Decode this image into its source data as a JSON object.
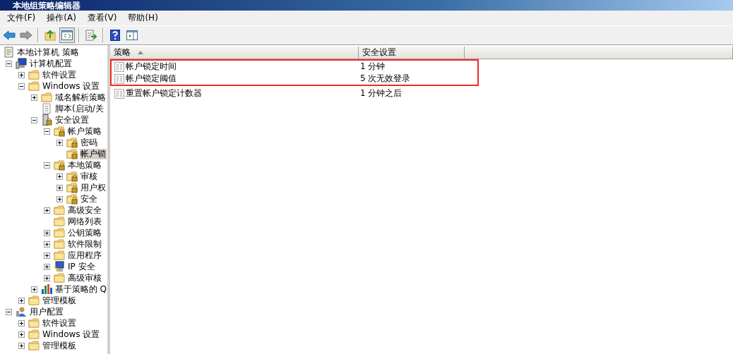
{
  "window": {
    "title": "本地组策略编辑器"
  },
  "menu": [
    "文件(F)",
    "操作(A)",
    "查看(V)",
    "帮助(H)"
  ],
  "toolbar": [
    {
      "kind": "back",
      "pressed": false
    },
    {
      "kind": "forward",
      "pressed": false
    },
    {
      "kind": "sep"
    },
    {
      "kind": "up",
      "pressed": false
    },
    {
      "kind": "tree",
      "pressed": true
    },
    {
      "kind": "sep"
    },
    {
      "kind": "export",
      "pressed": false
    },
    {
      "kind": "sep"
    },
    {
      "kind": "help",
      "pressed": false
    },
    {
      "kind": "pane",
      "pressed": false
    }
  ],
  "tree": {
    "label": "本地计算机 策略",
    "kind": "doc",
    "selected": false,
    "children": [
      {
        "label": "计算机配置",
        "kind": "computer",
        "expanded": true,
        "selected": false,
        "children": [
          {
            "label": "软件设置",
            "kind": "folder",
            "expanded": false,
            "selected": false
          },
          {
            "label": "Windows 设置",
            "kind": "folder",
            "expanded": true,
            "selected": false,
            "children": [
              {
                "label": "域名解析策略",
                "kind": "folder",
                "expanded": false,
                "selected": false
              },
              {
                "label": "脚本(启动/关",
                "kind": "script",
                "selected": false
              },
              {
                "label": "安全设置",
                "kind": "shield",
                "expanded": true,
                "selected": false,
                "children": [
                  {
                    "label": "帐户策略",
                    "kind": "lockfolder",
                    "expanded": true,
                    "selected": false,
                    "children": [
                      {
                        "label": "密码",
                        "kind": "lockfolder",
                        "expanded": false,
                        "selected": false
                      },
                      {
                        "label": "帐户锁",
                        "kind": "lockfolder",
                        "selected": true
                      }
                    ]
                  },
                  {
                    "label": "本地策略",
                    "kind": "lockfolder",
                    "expanded": true,
                    "selected": false,
                    "children": [
                      {
                        "label": "审核",
                        "kind": "lockfolder",
                        "expanded": false,
                        "selected": false
                      },
                      {
                        "label": "用户权",
                        "kind": "lockfolder",
                        "expanded": false,
                        "selected": false
                      },
                      {
                        "label": "安全",
                        "kind": "lockfolder",
                        "expanded": false,
                        "selected": false
                      }
                    ]
                  },
                  {
                    "label": "高级安全",
                    "kind": "folder",
                    "expanded": false,
                    "selected": false
                  },
                  {
                    "label": "网络列表",
                    "kind": "folder",
                    "selected": false
                  },
                  {
                    "label": "公钥策略",
                    "kind": "folder",
                    "expanded": false,
                    "selected": false
                  },
                  {
                    "label": "软件限制",
                    "kind": "folder",
                    "expanded": false,
                    "selected": false
                  },
                  {
                    "label": "应用程序",
                    "kind": "folder",
                    "expanded": false,
                    "selected": false
                  },
                  {
                    "label": "IP 安全",
                    "kind": "ip",
                    "expanded": false,
                    "selected": false
                  },
                  {
                    "label": "高级审核",
                    "kind": "folder",
                    "expanded": false,
                    "selected": false
                  }
                ]
              },
              {
                "label": "基于策略的 Q",
                "kind": "chart",
                "expanded": false,
                "selected": false
              }
            ]
          },
          {
            "label": "管理模板",
            "kind": "folder",
            "expanded": false,
            "selected": false
          }
        ]
      },
      {
        "label": "用户配置",
        "kind": "user",
        "expanded": true,
        "selected": false,
        "children": [
          {
            "label": "软件设置",
            "kind": "folder",
            "expanded": false,
            "selected": false
          },
          {
            "label": "Windows 设置",
            "kind": "folder",
            "expanded": false,
            "selected": false
          },
          {
            "label": "管理模板",
            "kind": "folder",
            "expanded": false,
            "selected": false
          }
        ]
      }
    ]
  },
  "columns": [
    "策略",
    "安全设置"
  ],
  "rows": [
    {
      "policy": "帐户锁定时间",
      "setting": "1 分钟",
      "highlighted": true
    },
    {
      "policy": "帐户锁定阈值",
      "setting": "5 次无效登录",
      "highlighted": true
    },
    {
      "policy": "重置帐户锁定计数器",
      "setting": "1 分钟之后",
      "highlighted": false
    }
  ]
}
